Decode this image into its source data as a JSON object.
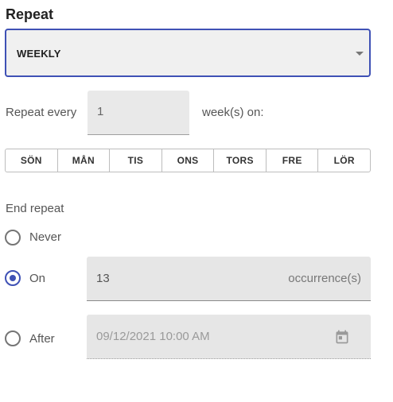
{
  "section_title": "Repeat",
  "repeat_select": {
    "value": "WEEKLY"
  },
  "repeat_every": {
    "label": "Repeat every",
    "value": "1",
    "suffix": "week(s) on:"
  },
  "weekdays": [
    "SÖN",
    "MÅN",
    "TIS",
    "ONS",
    "TORS",
    "FRE",
    "LÖR"
  ],
  "end_repeat": {
    "label": "End repeat",
    "options": [
      {
        "label": "Never",
        "checked": false
      },
      {
        "label": "On",
        "checked": true
      },
      {
        "label": "After",
        "checked": false
      }
    ],
    "occurrences": {
      "value": "13",
      "suffix": "occurrence(s)"
    },
    "date": {
      "value": "09/12/2021 10:00 AM",
      "icon": "calendar-icon"
    }
  },
  "colors": {
    "accent": "#3f51b5",
    "field_bg": "#e6e6e6"
  }
}
